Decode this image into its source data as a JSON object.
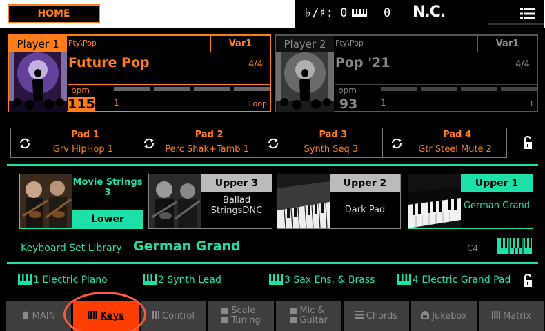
{
  "topbar": {
    "home_label": "HOME",
    "transpose": "♭/♯: 0",
    "octave": "0",
    "chord": "N.C.",
    "octave_icon": "keyboard-icon",
    "menu_icon": "menu-icon"
  },
  "player1": {
    "name": "Player 1",
    "category": "Fty\\Pop",
    "variation": "Var1",
    "style": "Future Pop",
    "meter": "4/4",
    "bpm_label": "bpm",
    "bpm": "115",
    "beat": "1",
    "mode": "Loop"
  },
  "player2": {
    "name": "Player 2",
    "category": "Fty\\Pop",
    "variation": "Var1",
    "style": "Pop '21",
    "meter": "4/4",
    "bpm_label": "bpm",
    "bpm": "93",
    "beat": "1",
    "beat_right": "1"
  },
  "pads": [
    {
      "name": "Pad 1",
      "sound": "Grv HipHop 1"
    },
    {
      "name": "Pad 2",
      "sound": "Perc Shak+Tamb 1"
    },
    {
      "name": "Pad 3",
      "sound": "Synth Seq 3"
    },
    {
      "name": "Pad 4",
      "sound": "Gtr Steel Mute 2"
    }
  ],
  "parts": {
    "lower": {
      "label": "Lower",
      "sound": "Movie Strings 3"
    },
    "upper3": {
      "label": "Upper 3",
      "sound": "Ballad StringsDNC"
    },
    "upper2": {
      "label": "Upper 2",
      "sound": "Dark Pad"
    },
    "upper1": {
      "label": "Upper 1",
      "sound": "German Grand"
    }
  },
  "keyboard_set": {
    "label": "Keyboard Set Library",
    "value": "German Grand",
    "split_note": "C4"
  },
  "kbd_slots": [
    {
      "num": "1",
      "name": "Electric Piano"
    },
    {
      "num": "2",
      "name": "Synth Lead"
    },
    {
      "num": "3",
      "name": "Sax Ens. & Brass"
    },
    {
      "num": "4",
      "name": "Electric Grand Pad"
    }
  ],
  "tabs": {
    "main": "MAIN",
    "keys": "Keys",
    "control": "Control",
    "scale_1": "Scale",
    "scale_2": "Tuning",
    "mic_1": "Mic &",
    "mic_2": "Guitar",
    "chords": "Chords",
    "jukebox": "Jukebox",
    "matrix": "Matrix"
  },
  "colors": {
    "accent_orange": "#ff7d1a",
    "accent_green": "#1ee1a9",
    "active_tab": "#ff3d00"
  }
}
